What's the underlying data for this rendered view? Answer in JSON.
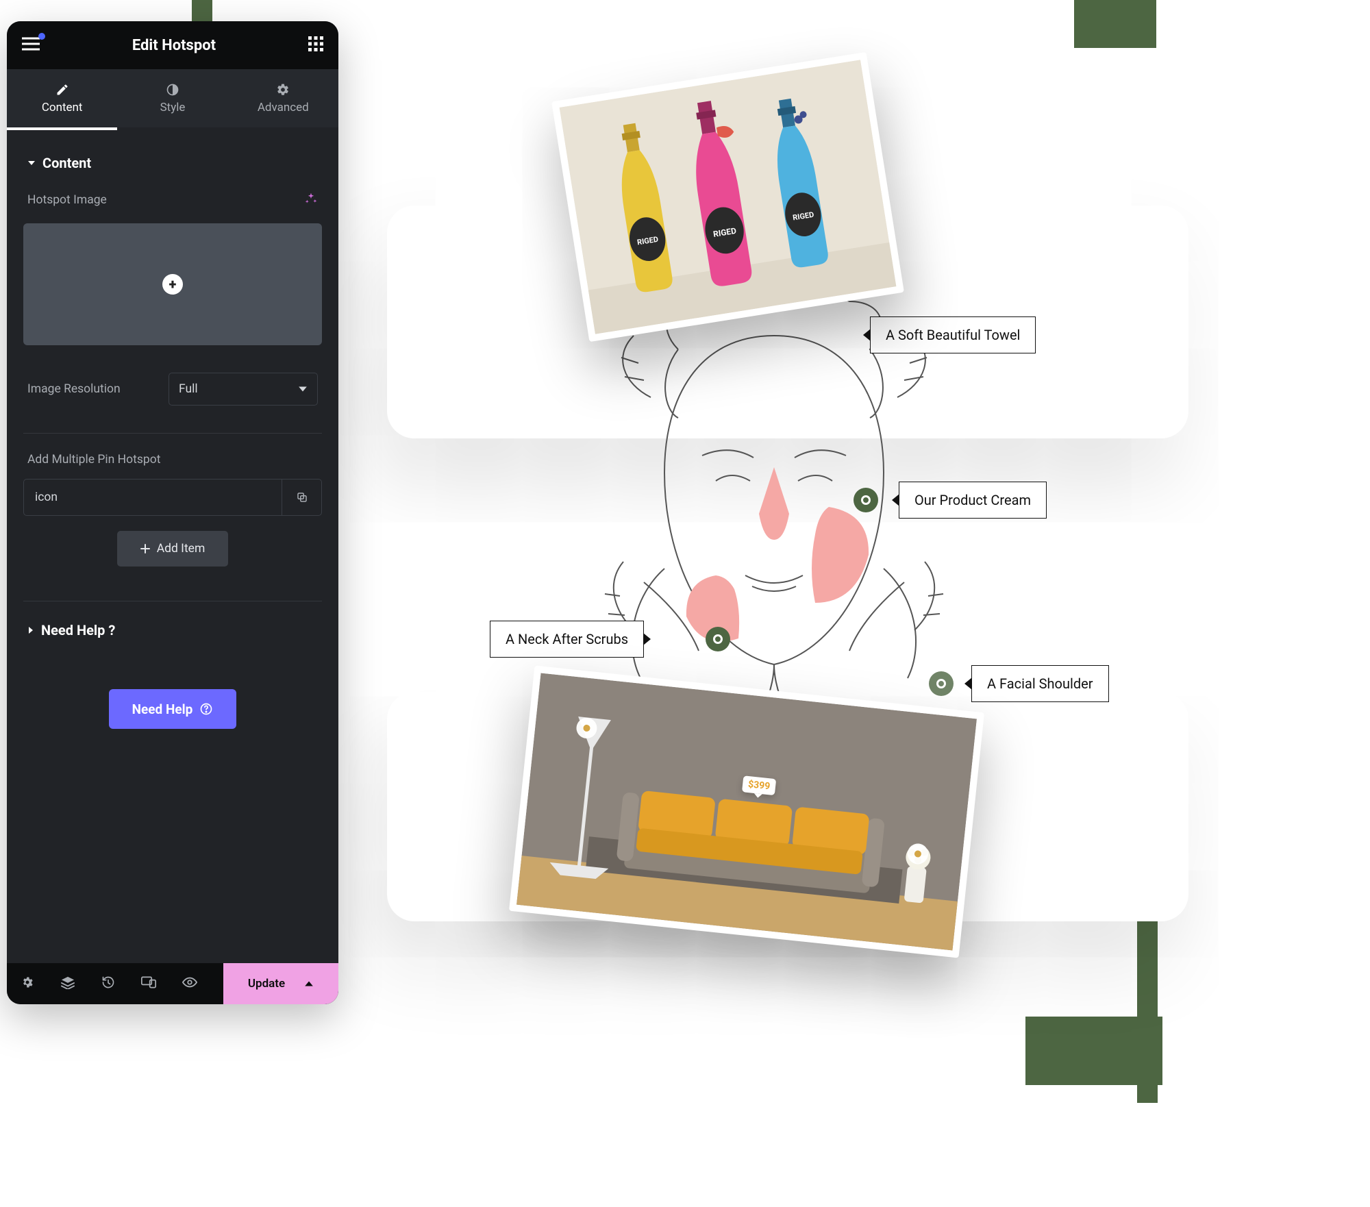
{
  "panel": {
    "title": "Edit Hotspot",
    "tabs": {
      "content": "Content",
      "style": "Style",
      "advanced": "Advanced"
    },
    "section_content": "Content",
    "hotspot_image_label": "Hotspot Image",
    "image_resolution_label": "Image Resolution",
    "image_resolution_value": "Full",
    "multipin_label": "Add Multiple Pin Hotspot",
    "repeater_item": "icon",
    "add_item": "Add Item",
    "need_help_section": "Need Help ?",
    "need_help_button": "Need Help",
    "update": "Update"
  },
  "hotspots": {
    "towel": "A Soft Beautiful Towel",
    "cream": "Our Product Cream",
    "neck": "A Neck After Scrubs",
    "shoulder": "A Facial Shoulder"
  },
  "sofa": {
    "price": "$399"
  },
  "bottles": {
    "brand": "RIGED"
  }
}
